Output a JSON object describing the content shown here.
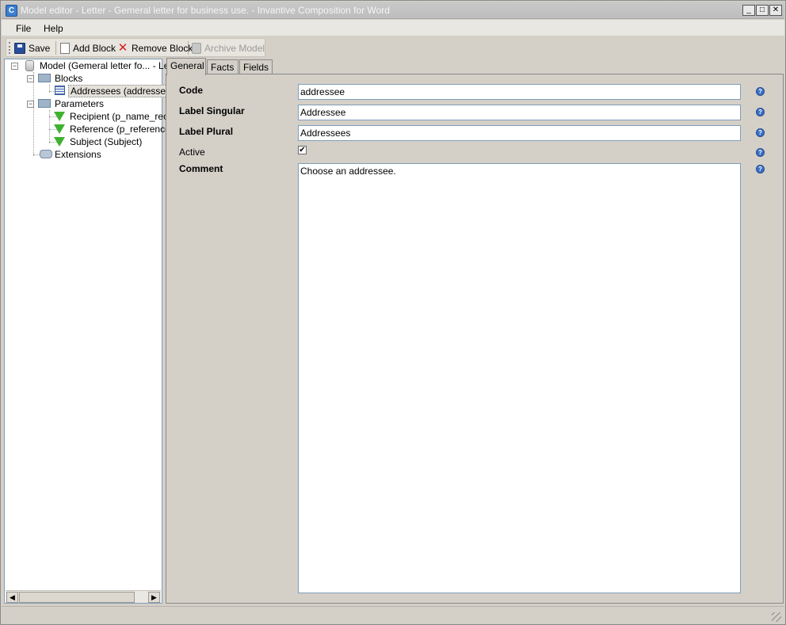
{
  "window": {
    "title": "Model editor - Letter - Gemeral letter for business use. - Invantive Composition for Word",
    "app_icon_letter": "C",
    "minimize": "_",
    "maximize": "□",
    "close": "✕"
  },
  "menu": {
    "file": "File",
    "help": "Help"
  },
  "toolbar": {
    "save": "Save",
    "add_block": "Add Block",
    "remove_block": "Remove Block",
    "archive_model": "Archive Model"
  },
  "tree": {
    "root": "Model (Gemeral letter fo... - Lette",
    "blocks": "Blocks",
    "addressees": "Addressees (addressee)",
    "parameters": "Parameters",
    "recipient": "Recipient (p_name_recip",
    "reference": "Reference (p_reference)",
    "subject": "Subject (Subject)",
    "extensions": "Extensions"
  },
  "tabs": {
    "general": "General",
    "facts": "Facts",
    "fields": "Fields"
  },
  "form": {
    "code_label": "Code",
    "code_value": "addressee",
    "label_singular_label": "Label Singular",
    "label_singular_value": "Addressee",
    "label_plural_label": "Label Plural",
    "label_plural_value": "Addressees",
    "active_label": "Active",
    "active_checked": "✔",
    "comment_label": "Comment",
    "comment_value": "Choose an addressee."
  },
  "icons": {
    "help": "?",
    "scroll_left": "◀",
    "scroll_right": "▶",
    "expander_minus": "−"
  }
}
